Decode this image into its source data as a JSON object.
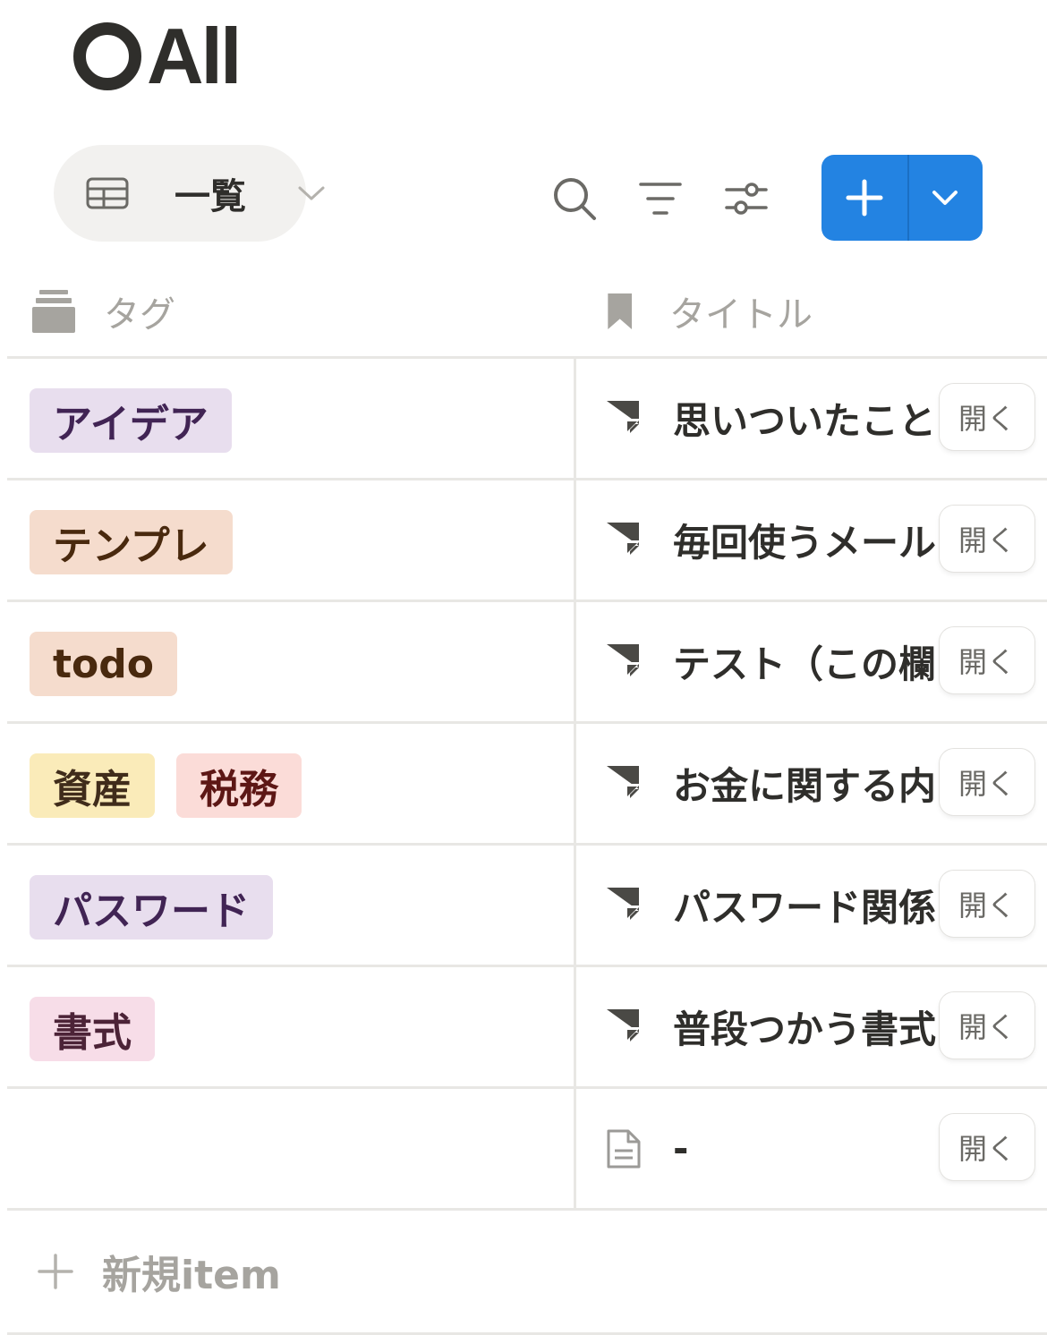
{
  "page": {
    "title": "All"
  },
  "toolbar": {
    "view_label": "一覧",
    "view_icon": "table-icon",
    "search_icon": "search-icon",
    "filter_icon": "filter-icon",
    "settings_icon": "sliders-icon",
    "new_icon": "plus-icon",
    "new_dropdown_icon": "chevron-down-icon",
    "accent_color": "#2383e2"
  },
  "table": {
    "columns": [
      {
        "label": "タグ",
        "icon": "tag-stack-icon"
      },
      {
        "label": "タイトル",
        "icon": "bookmark-icon"
      }
    ],
    "open_label": "開く",
    "rows": [
      {
        "tags": [
          {
            "label": "アイデア",
            "bg": "#e8deee",
            "fg": "#412454"
          }
        ],
        "title": "思いついたこと",
        "icon": "note-icon"
      },
      {
        "tags": [
          {
            "label": "テンプレ",
            "bg": "#f5dccd",
            "fg": "#49290e"
          }
        ],
        "title": "毎回使うメール",
        "icon": "note-icon"
      },
      {
        "tags": [
          {
            "label": "todo",
            "bg": "#f5dccd",
            "fg": "#49290e"
          }
        ],
        "title": "テスト（この欄",
        "icon": "note-icon"
      },
      {
        "tags": [
          {
            "label": "資産",
            "bg": "#faebb9",
            "fg": "#402c1b"
          },
          {
            "label": "税務",
            "bg": "#fbdcd8",
            "fg": "#5d1715"
          }
        ],
        "title": "お金に関する内",
        "icon": "note-icon"
      },
      {
        "tags": [
          {
            "label": "パスワード",
            "bg": "#e8deee",
            "fg": "#412454"
          }
        ],
        "title": "パスワード関係",
        "icon": "note-icon"
      },
      {
        "tags": [
          {
            "label": "書式",
            "bg": "#f7dde8",
            "fg": "#4c2337"
          }
        ],
        "title": "普段つかう書式",
        "icon": "note-icon"
      },
      {
        "tags": [],
        "title": "-",
        "icon": "page-icon"
      }
    ],
    "new_item_label": "新規item"
  }
}
